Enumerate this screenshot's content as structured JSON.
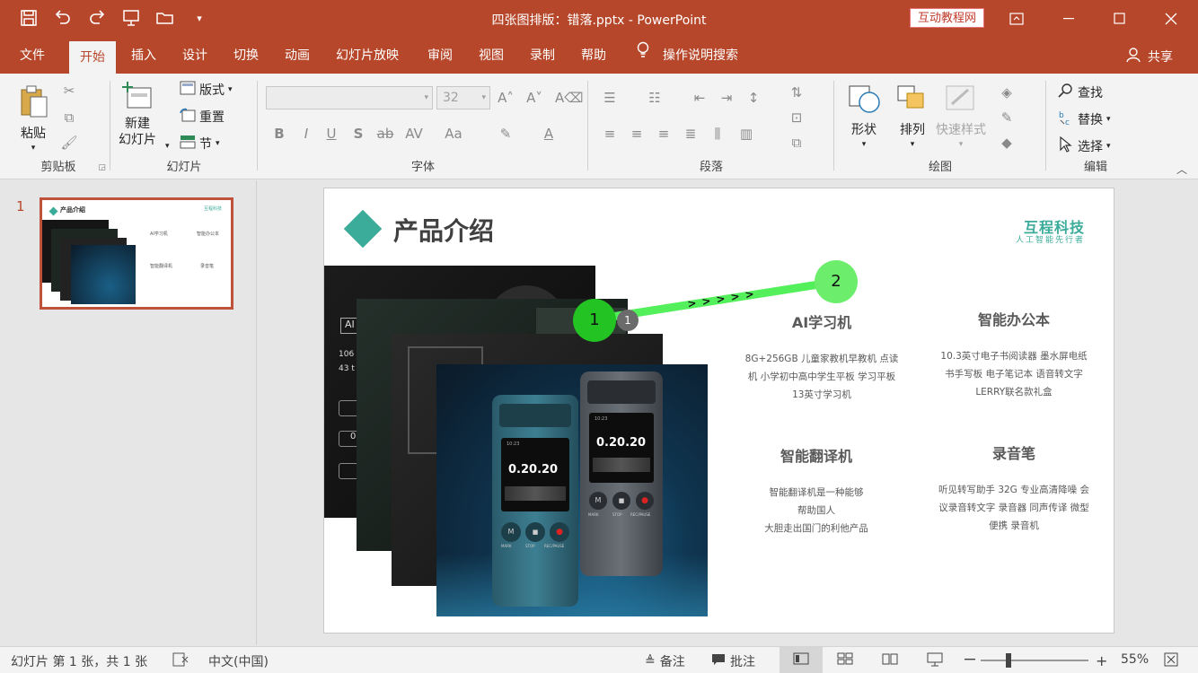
{
  "window": {
    "title": "四张图排版：错落.pptx  -  PowerPoint",
    "tutorial_badge": "互动教程网"
  },
  "tabs": [
    "文件",
    "开始",
    "插入",
    "设计",
    "切换",
    "动画",
    "幻灯片放映",
    "审阅",
    "视图",
    "录制",
    "帮助"
  ],
  "active_tab": "开始",
  "tell_me": "操作说明搜索",
  "share": "共享",
  "ribbon": {
    "clipboard": {
      "paste": "粘贴",
      "label": "剪贴板"
    },
    "slides": {
      "new_slide_l1": "新建",
      "new_slide_l2": "幻灯片",
      "layout": "版式",
      "reset": "重置",
      "section": "节",
      "label": "幻灯片"
    },
    "font": {
      "size": "32",
      "label": "字体"
    },
    "paragraph": {
      "label": "段落"
    },
    "drawing": {
      "shapes": "形状",
      "arrange": "排列",
      "quick_styles": "快速样式",
      "label": "绘图"
    },
    "editing": {
      "find": "查找",
      "replace": "替换",
      "select": "选择",
      "label": "编辑"
    }
  },
  "slide_pane": {
    "slide_number": "1"
  },
  "thumbnail": {
    "title": "产品介绍",
    "brand": "互程科技",
    "items": [
      "AI学习机",
      "智能办公本",
      "智能翻译机",
      "录音笔"
    ]
  },
  "slide": {
    "title": "产品介绍",
    "brand_name": "互程科技",
    "brand_slogan": "人工智能先行者",
    "features": [
      {
        "title": "AI学习机",
        "desc": [
          "8G+256GB 儿童家教机早教机 点读",
          "机 小学初中高中学生平板 学习平板",
          "13英寸学习机"
        ]
      },
      {
        "title": "智能办公本",
        "desc": [
          "10.3英寸电子书阅读器 墨水屏电纸",
          "书手写板 电子笔记本 语音转文字",
          "LERRY联名款礼盒"
        ]
      },
      {
        "title": "智能翻译机",
        "desc": [
          "智能翻译机是一种能够",
          "帮助国人",
          "大胆走出国门的利他产品"
        ]
      },
      {
        "title": "录音笔",
        "desc": [
          "听见转写助手 32G 专业高清降噪 会",
          "议录音转文字 录音器 同声传译 微型",
          "便携 录音机"
        ]
      }
    ],
    "photo_texts": {
      "p1": [
        "AI",
        "106",
        "43 t",
        "0"
      ],
      "device_display": "0.20.20",
      "device_time": "10:23",
      "buttons": [
        "M",
        "■",
        "●"
      ],
      "button_labels": [
        "MARK",
        "STOP",
        "REC/PAUSE"
      ]
    }
  },
  "annotation": {
    "marker_1": "1",
    "marker_2": "2",
    "small_badge": "1",
    "arrow_text": "> > > > >"
  },
  "status": {
    "slide_info": "幻灯片 第 1 张，共 1 张",
    "language": "中文(中国)",
    "notes": "备注",
    "comments": "批注",
    "zoom": "55%"
  },
  "colors": {
    "accent": "#b7472a",
    "brand_teal": "#3bab9a",
    "marker_green": "#3fdc3f"
  }
}
